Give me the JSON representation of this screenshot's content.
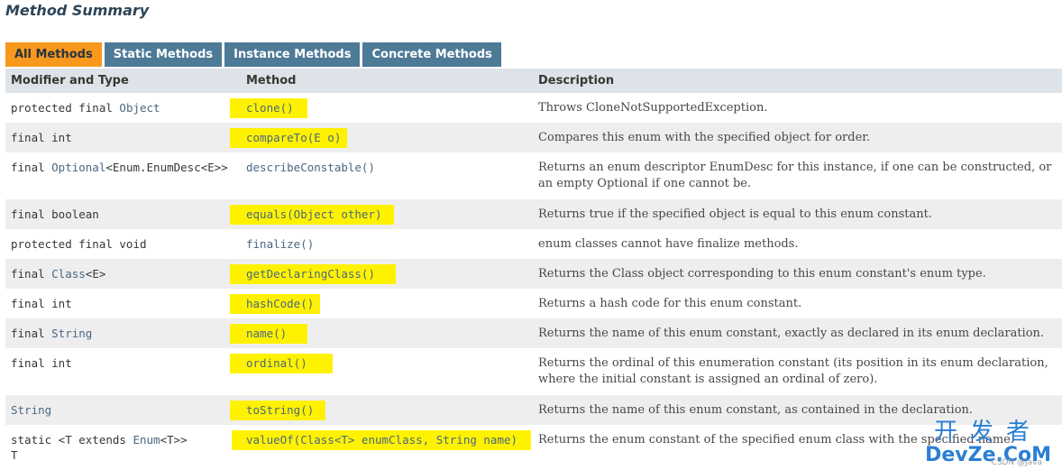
{
  "title": "Method Summary",
  "tabs": [
    "All Methods",
    "Static Methods",
    "Instance Methods",
    "Concrete Methods"
  ],
  "headers": {
    "modifier": "Modifier and Type",
    "method": "Method",
    "description": "Description"
  },
  "rows": [
    {
      "mod_pre": "protected final ",
      "mod_link": "Object",
      "mod_post": "",
      "mod_line2": "",
      "method": "clone()",
      "desc": "Throws CloneNotSupportedException.",
      "desc_line2": ""
    },
    {
      "mod_pre": "final int",
      "mod_link": "",
      "mod_post": "",
      "mod_line2": "",
      "method": "compareTo(E o)",
      "desc": "Compares this enum with the specified object for order.",
      "desc_line2": ""
    },
    {
      "mod_pre": "final ",
      "mod_link": "Optional",
      "mod_post": "<Enum.EnumDesc<E>>",
      "mod_line2": "",
      "method": "describeConstable()",
      "desc": "Returns an enum descriptor EnumDesc for this instance, if one can be constructed, or",
      "desc_line2": "an empty Optional if one cannot be."
    },
    {
      "mod_pre": "final boolean",
      "mod_link": "",
      "mod_post": "",
      "mod_line2": "",
      "method": "equals(Object other)",
      "desc": "Returns true if the specified object is equal to this enum constant.",
      "desc_line2": ""
    },
    {
      "mod_pre": "protected final void",
      "mod_link": "",
      "mod_post": "",
      "mod_line2": "",
      "method": "finalize()",
      "desc": "enum classes cannot have finalize methods.",
      "desc_line2": ""
    },
    {
      "mod_pre": "final ",
      "mod_link": "Class",
      "mod_post": "<E>",
      "mod_line2": "",
      "method": "getDeclaringClass()",
      "desc": "Returns the Class object corresponding to this enum constant's enum type.",
      "desc_line2": ""
    },
    {
      "mod_pre": "final int",
      "mod_link": "",
      "mod_post": "",
      "mod_line2": "",
      "method": "hashCode()",
      "desc": "Returns a hash code for this enum constant.",
      "desc_line2": ""
    },
    {
      "mod_pre": "final ",
      "mod_link": "String",
      "mod_post": "",
      "mod_line2": "",
      "method": "name()",
      "desc": "Returns the name of this enum constant, exactly as declared in its enum declaration.",
      "desc_line2": ""
    },
    {
      "mod_pre": "final int",
      "mod_link": "",
      "mod_post": "",
      "mod_line2": "",
      "method": "ordinal()",
      "desc": "Returns the ordinal of this enumeration constant (its position in its enum declaration,",
      "desc_line2": "where the initial constant is assigned an ordinal of zero)."
    },
    {
      "mod_pre": "",
      "mod_link": "String",
      "mod_post": "",
      "mod_line2": "",
      "method": "toString()",
      "desc": "Returns the name of this enum constant, as contained in the declaration.",
      "desc_line2": ""
    },
    {
      "mod_pre": "static <T extends ",
      "mod_link": "Enum",
      "mod_post": "<T>>",
      "mod_line2": "T",
      "method": "valueOf(Class<T> enumClass, String name)",
      "desc": "Returns the enum constant of the specified enum class with the specified name.",
      "desc_line2": ""
    }
  ],
  "logo": {
    "cn": "开发者",
    "en": "DevZe.CoM"
  },
  "watermark": "CSDN @Java"
}
